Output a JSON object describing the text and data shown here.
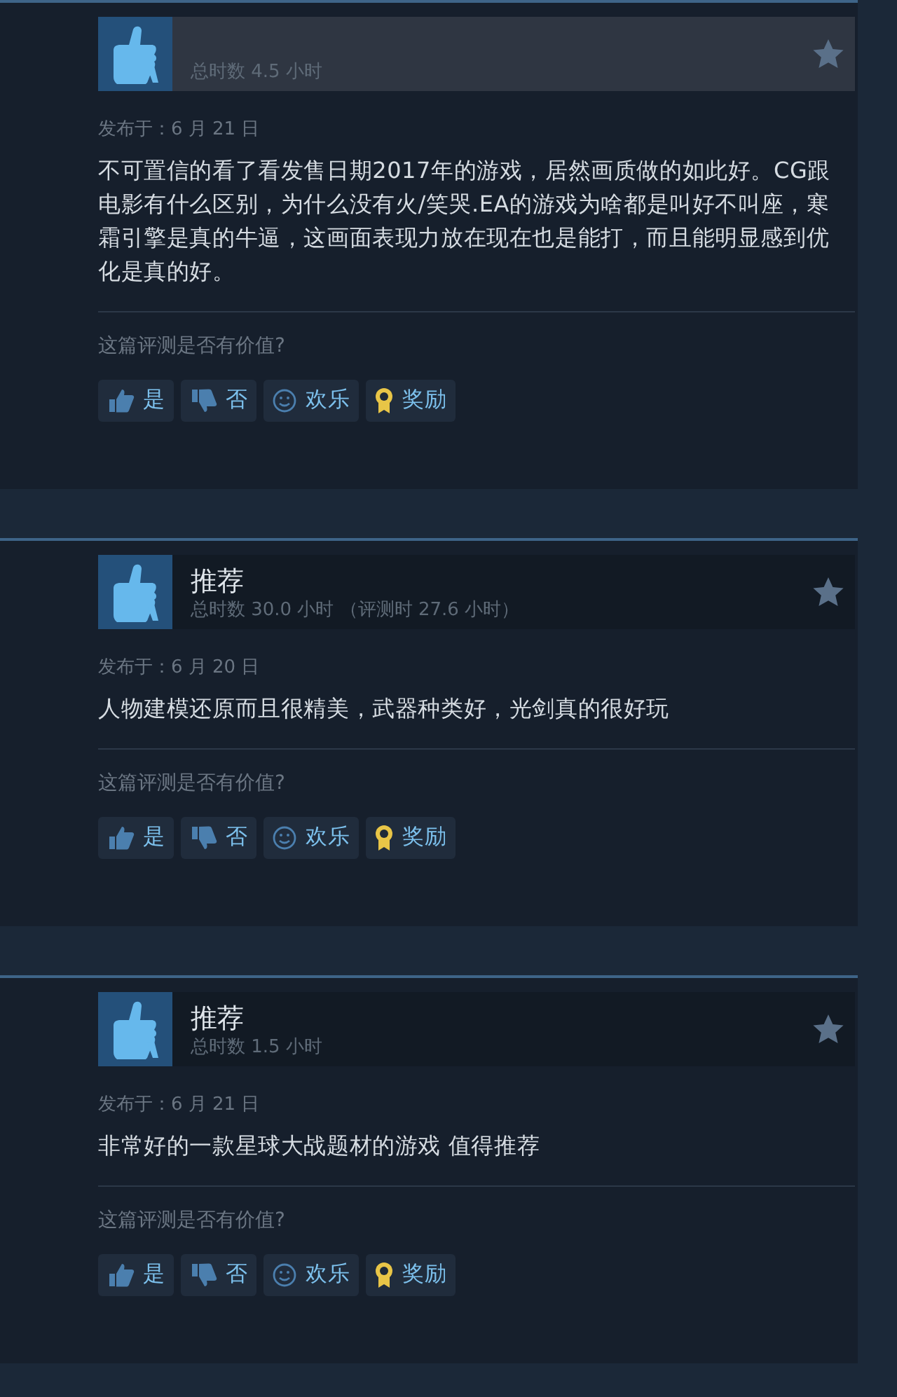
{
  "reviews": [
    {
      "highlighted": true,
      "playtime": "总时数 4.5 小时",
      "posted": "发布于：6 月 21 日",
      "body": "不可置信的看了看发售日期2017年的游戏，居然画质做的如此好。CG跟电影有什么区别，为什么没有火/笑哭.EA的游戏为啥都是叫好不叫座，寒霜引擎是真的牛逼，这画面表现力放在现在也是能打，而且能明显感到优化是真的好。",
      "prompt": "这篇评测是否有价值?",
      "buttons": [
        {
          "kind": "yes",
          "label": "是"
        },
        {
          "kind": "no",
          "label": "否"
        },
        {
          "kind": "funny",
          "label": "欢乐"
        },
        {
          "kind": "award",
          "label": "奖励"
        }
      ]
    },
    {
      "highlighted": false,
      "title": "推荐",
      "playtime": "总时数 30.0 小时 （评测时 27.6 小时）",
      "posted": "发布于：6 月 20 日",
      "body": "人物建模还原而且很精美，武器种类好，光剑真的很好玩",
      "prompt": "这篇评测是否有价值?",
      "buttons": [
        {
          "kind": "yes",
          "label": "是"
        },
        {
          "kind": "no",
          "label": "否"
        },
        {
          "kind": "funny",
          "label": "欢乐"
        },
        {
          "kind": "award",
          "label": "奖励"
        }
      ]
    },
    {
      "highlighted": false,
      "title": "推荐",
      "playtime": "总时数 1.5 小时",
      "posted": "发布于：6 月 21 日",
      "body": "非常好的一款星球大战题材的游戏 值得推荐",
      "prompt": "这篇评测是否有价值?",
      "buttons": [
        {
          "kind": "yes",
          "label": "是"
        },
        {
          "kind": "no",
          "label": "否"
        },
        {
          "kind": "funny",
          "label": "欢乐"
        },
        {
          "kind": "award",
          "label": "奖励"
        }
      ]
    }
  ]
}
